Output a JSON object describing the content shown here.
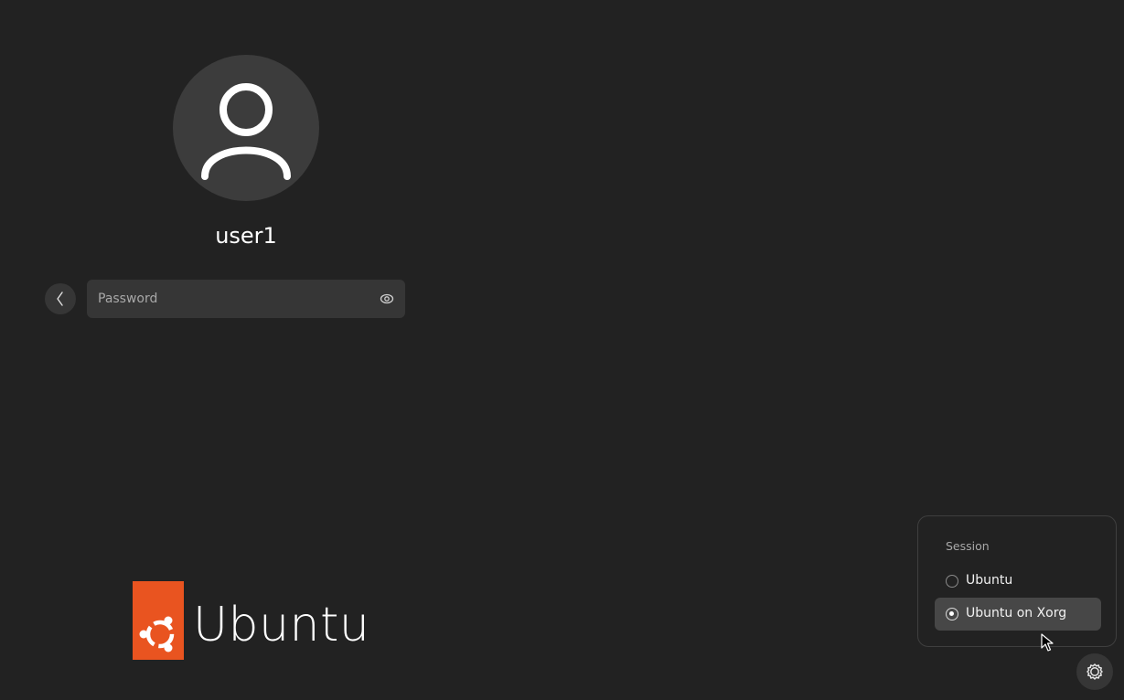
{
  "user": {
    "name": "user1",
    "avatar_icon": "user-avatar-icon"
  },
  "login": {
    "back_icon": "chevron-left-icon",
    "password_placeholder": "Password",
    "password_value": "",
    "reveal_icon": "eye-icon"
  },
  "branding": {
    "logo_text": "Ubuntu",
    "logo_color": "#e95420"
  },
  "session_menu": {
    "title": "Session",
    "items": [
      {
        "label": "Ubuntu",
        "selected": false
      },
      {
        "label": "Ubuntu on Xorg",
        "selected": true
      }
    ]
  },
  "settings": {
    "icon": "gear-icon"
  },
  "colors": {
    "background": "#222222",
    "accent": "#e95420"
  }
}
